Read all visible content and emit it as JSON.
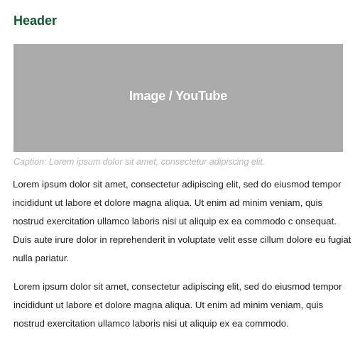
{
  "header": {
    "title": "Header"
  },
  "media": {
    "label": "Image / YouTube"
  },
  "caption": {
    "text": "Caption: Lorem ipsum dolor sit amet, consectetur adipiscing elit."
  },
  "body": {
    "paragraphs": [
      "Lorem ipsum dolor sit amet, consectetur adipiscing elit, sed do eiusmod tempor incididunt ut labore et dolore magna aliqua. Ut enim ad minim veniam, quis nostrud exercitation ullamco laboris nisi ut aliquip ex ea commodo c onsequat. Duis aute irure dolor in reprehenderit in voluptate velit esse cillum dolore eu fugiat nulla pariatur.",
      "Lorem ipsum dolor sit amet, consectetur adipiscing elit, sed do eiusmod tempor incididunt ut labore et dolore magna aliqua. Ut enim ad minim veniam, quis nostrud exercitation ullamco laboris nisi ut aliquip ex ea commodo."
    ]
  },
  "colors": {
    "header": "#0f5a2c",
    "media_placeholder": "#aaaaaa",
    "caption": "#b7b7b7",
    "body_text": "#1f1f1f"
  }
}
